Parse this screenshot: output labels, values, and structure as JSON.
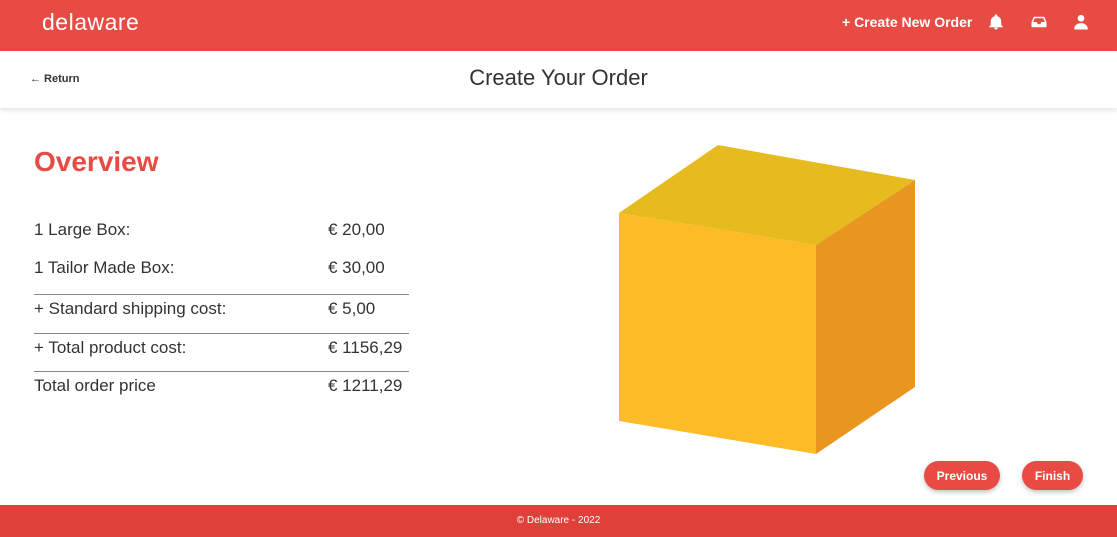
{
  "brand": {
    "logo_text": "delaware",
    "primary_color": "#e84b44"
  },
  "nav": {
    "create_new_order": "+ Create New Order",
    "icons": [
      "bell-icon",
      "inbox-icon",
      "user-icon"
    ]
  },
  "subheader": {
    "return_label": "← Return",
    "title": "Create Your Order"
  },
  "overview": {
    "title": "Overview",
    "rows": [
      {
        "label": "1 Large Box:",
        "value": "€ 20,00"
      },
      {
        "label": "1 Tailor Made Box:",
        "value": "€ 30,00"
      },
      {
        "label": "+ Standard shipping cost:",
        "value": "€ 5,00"
      },
      {
        "label": "+ Total product cost:",
        "value": "€ 1156,29"
      },
      {
        "label": "Total order price",
        "value": "€ 1211,29"
      }
    ]
  },
  "preview": {
    "colors": {
      "top": "#e6bb1f",
      "front": "#fdbb28",
      "side": "#e8961f"
    }
  },
  "actions": {
    "previous": "Previous",
    "finish": "Finish"
  },
  "footer": {
    "text": "© Delaware - 2022"
  }
}
